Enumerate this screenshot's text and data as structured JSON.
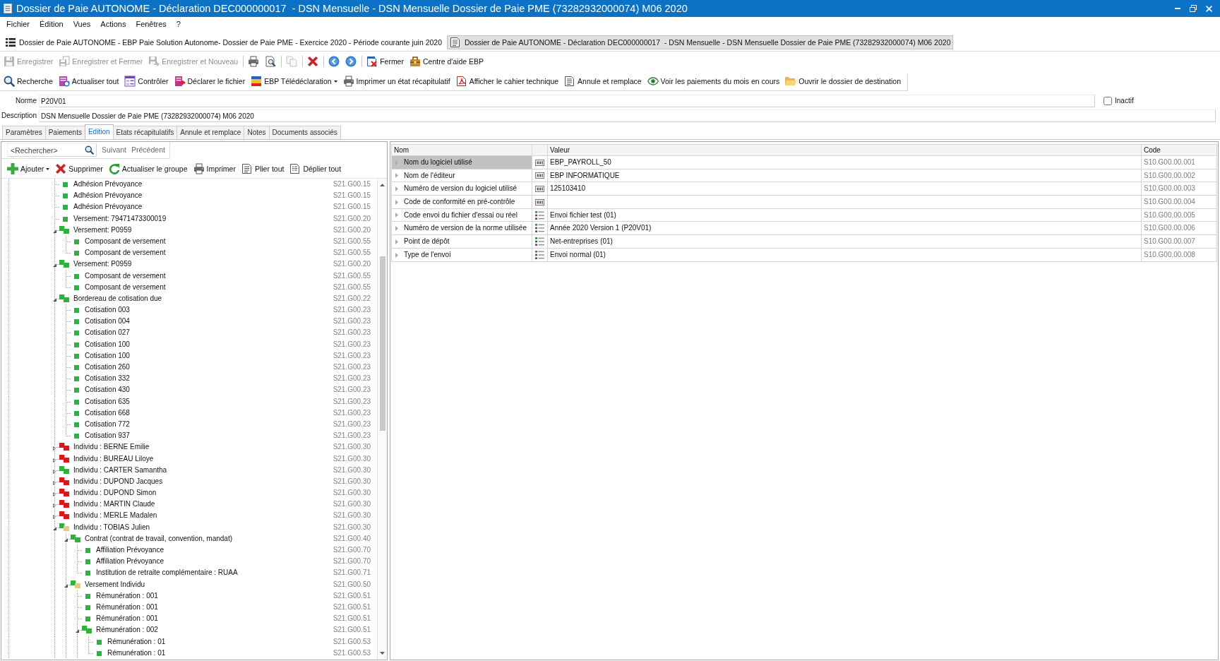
{
  "window": {
    "title": "Dossier de Paie AUTONOME - Déclaration DEC000000017  - DSN Mensuelle - DSN Mensuelle Dossier de Paie PME (73282932000074) M06 2020"
  },
  "menu": [
    "Fichier",
    "Édition",
    "Vues",
    "Actions",
    "Fenêtres",
    "?"
  ],
  "document_tabs": [
    {
      "label": "Dossier de Paie AUTONOME - EBP Paie Solution Autonome- Dossier de Paie PME - Exercice 2020 - Période courante juin 2020",
      "selected": false
    },
    {
      "label": "Dossier de Paie AUTONOME - Déclaration DEC000000017  - DSN Mensuelle - DSN Mensuelle Dossier de Paie PME (73282932000074) M06 2020",
      "selected": true
    }
  ],
  "main_toolbar": {
    "groups": [
      {
        "buttons": [
          {
            "label": "Enregistrer",
            "disabled": true
          },
          {
            "label": "Enregistrer et Fermer",
            "disabled": true
          },
          {
            "label": "Enregistrer et Nouveau",
            "disabled": true
          }
        ]
      },
      {
        "buttons": [
          {
            "disabled": false
          },
          {
            "disabled": false
          }
        ]
      },
      {
        "buttons": [
          {
            "disabled": true
          }
        ]
      },
      {
        "buttons": [
          {
            "disabled": false
          }
        ]
      },
      {
        "buttons": [
          {
            "disabled": false
          },
          {
            "disabled": false
          }
        ]
      },
      {
        "buttons": [
          {
            "label": "Fermer",
            "disabled": false
          },
          {
            "label": "Centre d'aide EBP",
            "disabled": false
          }
        ]
      }
    ]
  },
  "action_toolbar": [
    {
      "label": "Recherche",
      "kind": "button"
    },
    {
      "label": "Actualiser tout",
      "kind": "button"
    },
    {
      "label": "Contrôler",
      "kind": "button"
    },
    {
      "label": "Déclarer le fichier",
      "kind": "button"
    },
    {
      "label": "EBP Télédéclaration",
      "kind": "dropdown"
    },
    {
      "label": "Imprimer un état récapitulatif",
      "kind": "button"
    },
    {
      "label": "Afficher le cahier technique",
      "kind": "button"
    },
    {
      "label": "Annule et remplace",
      "kind": "button"
    },
    {
      "label": "Voir les paiements du mois en cours",
      "kind": "button"
    },
    {
      "label": "Ouvrir le dossier de destination",
      "kind": "button"
    }
  ],
  "form": {
    "fields": [
      {
        "label": "Norme",
        "value": "P20V01"
      },
      {
        "label": "Description",
        "value": "DSN Mensuelle Dossier de Paie PME (73282932000074) M06 2020"
      }
    ],
    "inactive_checkbox": {
      "label": "Inactif",
      "checked": false
    }
  },
  "tabs": [
    {
      "label": "Paramètres",
      "selected": false
    },
    {
      "label": "Paiements",
      "selected": false
    },
    {
      "label": "Edition",
      "selected": true
    },
    {
      "label": "Etats récapitulatifs",
      "selected": false
    },
    {
      "label": "Annule et remplace",
      "selected": false
    },
    {
      "label": "Notes",
      "selected": false
    },
    {
      "label": "Documents associés",
      "selected": false
    }
  ],
  "tree_panel": {
    "search": {
      "placeholder": "<Rechercher>",
      "links": [
        "Suivant",
        "Précédent"
      ]
    },
    "toolbar": [
      {
        "label": "Ajouter",
        "kind": "dropdown"
      },
      {
        "label": "Supprimer",
        "kind": "button"
      },
      {
        "label": "Actualiser le groupe",
        "kind": "button"
      },
      {
        "label": "Imprimer",
        "kind": "button"
      },
      {
        "label": "Plier tout",
        "kind": "button"
      },
      {
        "label": "Déplier tout",
        "kind": "button"
      }
    ],
    "tree": {
      "items": [
        {
          "kind": "leaf",
          "label": "Adhésion Prévoyance",
          "code": "S21.G00.15",
          "squares": [
            {
              "color": "#2bb33b"
            }
          ]
        },
        {
          "kind": "leaf",
          "label": "Adhésion Prévoyance",
          "code": "S21.G00.15",
          "squares": [
            {
              "color": "#2bb33b"
            }
          ]
        },
        {
          "kind": "leaf",
          "label": "Adhésion Prévoyance",
          "code": "S21.G00.15",
          "squares": [
            {
              "color": "#2bb33b"
            }
          ]
        },
        {
          "kind": "leaf",
          "label": "Versement: 79471473300019",
          "code": "S21.G00.20",
          "squares": [
            {
              "color": "#2bb33b"
            }
          ]
        },
        {
          "kind": "group",
          "label": "Versement: P0959",
          "code": "S21.G00.20",
          "squares": [
            {
              "color": "#2bb33b"
            },
            {
              "color": "#2bb33b"
            }
          ],
          "expanded": true,
          "children": [
            {
              "kind": "leaf",
              "label": "Composant de versement",
              "code": "S21.G00.55",
              "squares": [
                {
                  "color": "#2bb33b"
                }
              ]
            },
            {
              "kind": "leaf",
              "label": "Composant de versement",
              "code": "S21.G00.55",
              "squares": [
                {
                  "color": "#2bb33b"
                }
              ]
            }
          ]
        },
        {
          "kind": "group",
          "label": "Versement: P0959",
          "code": "S21.G00.20",
          "squares": [
            {
              "color": "#2bb33b"
            },
            {
              "color": "#2bb33b"
            }
          ],
          "expanded": true,
          "children": [
            {
              "kind": "leaf",
              "label": "Composant de versement",
              "code": "S21.G00.55",
              "squares": [
                {
                  "color": "#2bb33b"
                }
              ]
            },
            {
              "kind": "leaf",
              "label": "Composant de versement",
              "code": "S21.G00.55",
              "squares": [
                {
                  "color": "#2bb33b"
                }
              ]
            }
          ]
        },
        {
          "kind": "group",
          "label": "Bordereau de cotisation due",
          "code": "S21.G00.22",
          "squares": [
            {
              "color": "#2bb33b"
            },
            {
              "color": "#2bb33b"
            }
          ],
          "expanded": true,
          "children": [
            {
              "kind": "leaf",
              "label": "Cotisation 003",
              "code": "S21.G00.23",
              "squares": [
                {
                  "color": "#2bb33b"
                }
              ]
            },
            {
              "kind": "leaf",
              "label": "Cotisation 004",
              "code": "S21.G00.23",
              "squares": [
                {
                  "color": "#2bb33b"
                }
              ]
            },
            {
              "kind": "leaf",
              "label": "Cotisation 027",
              "code": "S21.G00.23",
              "squares": [
                {
                  "color": "#2bb33b"
                }
              ]
            },
            {
              "kind": "leaf",
              "label": "Cotisation 100",
              "code": "S21.G00.23",
              "squares": [
                {
                  "color": "#2bb33b"
                }
              ]
            },
            {
              "kind": "leaf",
              "label": "Cotisation 100",
              "code": "S21.G00.23",
              "squares": [
                {
                  "color": "#2bb33b"
                }
              ]
            },
            {
              "kind": "leaf",
              "label": "Cotisation 260",
              "code": "S21.G00.23",
              "squares": [
                {
                  "color": "#2bb33b"
                }
              ]
            },
            {
              "kind": "leaf",
              "label": "Cotisation 332",
              "code": "S21.G00.23",
              "squares": [
                {
                  "color": "#2bb33b"
                }
              ]
            },
            {
              "kind": "leaf",
              "label": "Cotisation 430",
              "code": "S21.G00.23",
              "squares": [
                {
                  "color": "#2bb33b"
                }
              ]
            },
            {
              "kind": "leaf",
              "label": "Cotisation 635",
              "code": "S21.G00.23",
              "squares": [
                {
                  "color": "#2bb33b"
                }
              ]
            },
            {
              "kind": "leaf",
              "label": "Cotisation 668",
              "code": "S21.G00.23",
              "squares": [
                {
                  "color": "#2bb33b"
                }
              ]
            },
            {
              "kind": "leaf",
              "label": "Cotisation 772",
              "code": "S21.G00.23",
              "squares": [
                {
                  "color": "#2bb33b"
                }
              ]
            },
            {
              "kind": "leaf",
              "label": "Cotisation 937",
              "code": "S21.G00.23",
              "squares": [
                {
                  "color": "#2bb33b"
                }
              ]
            }
          ]
        },
        {
          "kind": "group",
          "label": "Individu : BERNE Emilie",
          "code": "S21.G00.30",
          "squares": [
            {
              "color": "#e3131b"
            },
            {
              "color": "#e3131b"
            }
          ],
          "expanded": false
        },
        {
          "kind": "group",
          "label": "Individu : BUREAU Liloye",
          "code": "S21.G00.30",
          "squares": [
            {
              "color": "#e3131b"
            },
            {
              "color": "#e3131b"
            }
          ],
          "expanded": false
        },
        {
          "kind": "group",
          "label": "Individu : CARTER Samantha",
          "code": "S21.G00.30",
          "squares": [
            {
              "color": "#2bb33b"
            },
            {
              "color": "#2bb33b"
            }
          ],
          "expanded": false
        },
        {
          "kind": "group",
          "label": "Individu : DUPOND Jacques",
          "code": "S21.G00.30",
          "squares": [
            {
              "color": "#e3131b"
            },
            {
              "color": "#e3131b"
            }
          ],
          "expanded": false
        },
        {
          "kind": "group",
          "label": "Individu : DUPOND Simon",
          "code": "S21.G00.30",
          "squares": [
            {
              "color": "#e3131b"
            },
            {
              "color": "#e3131b"
            }
          ],
          "expanded": false
        },
        {
          "kind": "group",
          "label": "Individu : MARTIN Claude",
          "code": "S21.G00.30",
          "squares": [
            {
              "color": "#e3131b"
            },
            {
              "color": "#e3131b"
            }
          ],
          "expanded": false
        },
        {
          "kind": "group",
          "label": "Individu : MERLE Madalen",
          "code": "S21.G00.30",
          "squares": [
            {
              "color": "#e3131b"
            },
            {
              "color": "#e3131b"
            }
          ],
          "expanded": false
        },
        {
          "kind": "group",
          "label": "Individu : TOBIAS Julien",
          "code": "S21.G00.30",
          "squares": [
            {
              "color": "#2bb33b"
            },
            {
              "color": "#e8c886"
            }
          ],
          "expanded": true,
          "children": [
            {
              "kind": "group",
              "label": "Contrat (contrat de travail, convention, mandat)",
              "code": "S21.G00.40",
              "squares": [
                {
                  "color": "#2bb33b"
                },
                {
                  "color": "#2bb33b"
                }
              ],
              "expanded": true,
              "children": [
                {
                  "kind": "leaf",
                  "label": "Affiliation Prévoyance",
                  "code": "S21.G00.70",
                  "squares": [
                    {
                      "color": "#2bb33b"
                    }
                  ]
                },
                {
                  "kind": "leaf",
                  "label": "Affiliation Prévoyance",
                  "code": "S21.G00.70",
                  "squares": [
                    {
                      "color": "#2bb33b"
                    }
                  ]
                },
                {
                  "kind": "leaf",
                  "label": "Institution de retraite complémentaire : RUAA",
                  "code": "S21.G00.71",
                  "squares": [
                    {
                      "color": "#2bb33b"
                    }
                  ]
                }
              ]
            },
            {
              "kind": "group",
              "label": "Versement Individu",
              "code": "S21.G00.50",
              "squares": [
                {
                  "color": "#2bb33b"
                },
                {
                  "color": "#e8c886"
                }
              ],
              "expanded": true,
              "children": [
                {
                  "kind": "leaf",
                  "label": "Rémunération : 001",
                  "code": "S21.G00.51",
                  "squares": [
                    {
                      "color": "#2bb33b"
                    }
                  ]
                },
                {
                  "kind": "leaf",
                  "label": "Rémunération : 001",
                  "code": "S21.G00.51",
                  "squares": [
                    {
                      "color": "#2bb33b"
                    }
                  ]
                },
                {
                  "kind": "leaf",
                  "label": "Rémunération : 001",
                  "code": "S21.G00.51",
                  "squares": [
                    {
                      "color": "#2bb33b"
                    }
                  ]
                },
                {
                  "kind": "group",
                  "label": "Rémunération : 002",
                  "code": "S21.G00.51",
                  "squares": [
                    {
                      "color": "#2bb33b"
                    },
                    {
                      "color": "#2bb33b"
                    }
                  ],
                  "expanded": true,
                  "children": [
                    {
                      "kind": "leaf",
                      "label": "Rémunération : 01",
                      "code": "S21.G00.53",
                      "squares": [
                        {
                          "color": "#2bb33b"
                        }
                      ]
                    },
                    {
                      "kind": "leaf",
                      "label": "Rémunération : 01",
                      "code": "S21.G00.53",
                      "squares": [
                        {
                          "color": "#2bb33b"
                        }
                      ]
                    }
                  ]
                }
              ]
            }
          ]
        }
      ]
    }
  },
  "properties_table": {
    "columns": [
      "Nom",
      "Valeur",
      "Code"
    ],
    "rows": [
      {
        "name": "Nom du logiciel utilisé",
        "kind": "text",
        "value": "EBP_PAYROLL_50",
        "code": "S10.G00.00.001",
        "selected": true
      },
      {
        "name": "Nom de l'éditeur",
        "kind": "text",
        "value": "EBP INFORMATIQUE",
        "code": "S10.G00.00.002",
        "selected": false
      },
      {
        "name": "Numéro de version du logiciel utilisé",
        "kind": "text",
        "value": "125103410",
        "code": "S10.G00.00.003",
        "selected": false
      },
      {
        "name": "Code de conformité en pré-contrôle",
        "kind": "text",
        "code": "S10.G00.00.004",
        "selected": false
      },
      {
        "name": "Code envoi du fichier d'essai ou réel",
        "kind": "list",
        "value": "Envoi fichier test (01)",
        "code": "S10.G00.00.005",
        "selected": false
      },
      {
        "name": "Numéro de version de la norme utilisée",
        "kind": "list",
        "value": "Année 2020 Version 1 (P20V01)",
        "code": "S10.G00.00.006",
        "selected": false
      },
      {
        "name": "Point de dépôt",
        "kind": "list",
        "value": "Net-entreprises (01)",
        "code": "S10.G00.00.007",
        "selected": false
      },
      {
        "name": "Type de l'envoi",
        "kind": "list",
        "value": "Envoi normal (01)",
        "code": "S10.G00.00.008",
        "selected": false
      }
    ]
  }
}
